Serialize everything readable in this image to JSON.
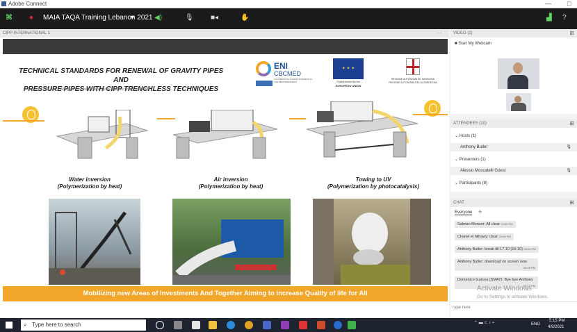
{
  "window": {
    "title": "Adobe Connect",
    "controls": [
      "—",
      "□"
    ]
  },
  "toolbar": {
    "meeting_name": "MAIA TAQA Training Lebanon 2021",
    "dropdown": "▾"
  },
  "share": {
    "header": "CIPP INTERNATIONAL 1",
    "menu": "···"
  },
  "slide": {
    "title_line1": "TECHNICAL STANDARDS FOR RENEWAL OF GRAVITY PIPES AND",
    "title_line2": "PRESSURE PIPES WITH CIPP TRENCHLESS TECHNIQUES",
    "copyright": "© Copyright 2019  IATT. All rights reserved. Full or partial reproduction  is prohibited.",
    "logos": {
      "eni": "ENI",
      "eni_sub": "CBCMED",
      "eni_tag": "COOPERATING ACROSS BORDERS IN THE MEDITERRANEAN",
      "eu_line1": "Project funded by the",
      "eu_line2": "EUROPEAN UNION",
      "region_line1": "REGIONE AUTÒNOMA DE SARDIGNA",
      "region_line2": "REGIONE AUTONOMA DELLA SARDEGNA"
    },
    "methods": [
      {
        "title": "Water inversion",
        "sub": "(Polymerization by heat)"
      },
      {
        "title": "Air inversion",
        "sub": "(Polymerization by heat)"
      },
      {
        "title": "Towing to UV",
        "sub": "(Polymerization by photocatalysis)"
      }
    ],
    "banner": "Mobilizing new Areas of Investments And Together Aiming to increase Quality of life for All",
    "colors": {
      "accent": "#f2a72b",
      "bulb": "#f6c230"
    }
  },
  "video": {
    "header": "VIDEO (2)",
    "start_webcam": "Start My Webcam"
  },
  "attendees": {
    "header": "ATTENDEES (10)",
    "groups": [
      {
        "label": "Hosts (1)",
        "members": [
          "Anthony Butler"
        ]
      },
      {
        "label": "Presenters (1)",
        "members": [
          "Alessio Moscatelli Guest"
        ]
      },
      {
        "label": "Participants (8)",
        "members": []
      }
    ]
  },
  "chat": {
    "header": "CHAT",
    "tab": "Everyone",
    "add": "+",
    "messages": [
      {
        "text": "Salman Monzer: All clear",
        "time": "04:59 PM"
      },
      {
        "text": "Chanel el hilhawy: clear",
        "time": "04:59 PM"
      },
      {
        "text": "Anthony Butler: break till 17:10 (15:10)",
        "time": "05:05 PM"
      },
      {
        "text": "Anthony Butler: download on screen now",
        "time": "05:05 PM"
      },
      {
        "text": "Domenico Garcea (SMAT): Bye bye Anthony",
        "time": "05:12 PM"
      }
    ],
    "input_placeholder": "Type here",
    "watermark_line1": "Activate Windows",
    "watermark_line2": "Go to Settings to activate Windows."
  },
  "taskbar": {
    "search_placeholder": "Type here to search",
    "lang": "ENG",
    "time": "5:15 PM",
    "date": "4/9/2021"
  }
}
